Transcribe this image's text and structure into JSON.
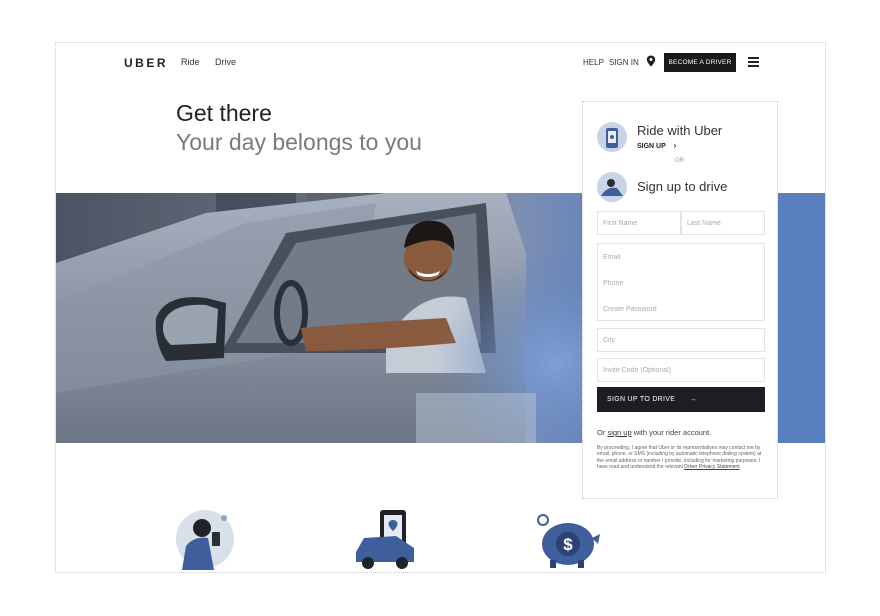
{
  "nav": {
    "logo": "UBER",
    "ride": "Ride",
    "drive": "Drive",
    "help": "HELP",
    "sign_in": "SIGN IN",
    "become_driver": "BECOME A DRIVER"
  },
  "hero": {
    "title": "Get there",
    "subtitle": "Your day belongs to you"
  },
  "panel": {
    "ride_title": "Ride with Uber",
    "ride_sub": "SIGN UP",
    "or": "OR",
    "drive_title": "Sign up to drive",
    "placeholders": {
      "first_name": "First Name",
      "last_name": "Last Name",
      "email": "Email",
      "phone": "Phone",
      "password": "Create Password",
      "city": "City",
      "invite": "Invite Code (Optional)"
    },
    "submit": "SIGN UP TO DRIVE",
    "submit_arrow": "→",
    "rider_prefix": "Or",
    "rider_link": "sign up",
    "rider_suffix": "with your rider account.",
    "legal": "By proceeding, I agree that Uber or its representatives may contact me by email, phone, or SMS (including by automatic telephone dialing system) at the email address or number I provide, including for marketing purposes. I have read and understand the relevant",
    "legal_link": "Driver Privacy Statement"
  },
  "colors": {
    "accent_blue": "#5a7fbf",
    "dark": "#1c1e24"
  }
}
